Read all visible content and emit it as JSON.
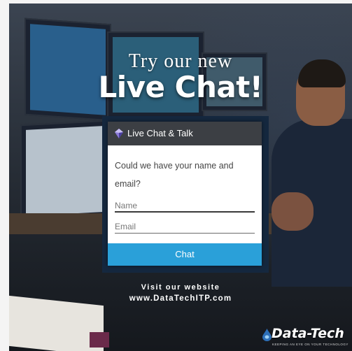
{
  "promo": {
    "headline_top": "Try our new",
    "headline_main": "Live Chat!",
    "visit_line1": "Visit our website",
    "visit_line2": "www.DataTechITP.com",
    "logo_name": "Data-Tech",
    "logo_tagline": "KEEPING AN EYE ON YOUR TECHNOLOGY"
  },
  "widget": {
    "header_icon": "gem-icon",
    "header_title": "Live Chat & Talk",
    "prompt": "Could we have your name and email?",
    "name_placeholder": "Name",
    "email_placeholder": "Email",
    "button_label": "Chat",
    "button_color": "#2aa0d9",
    "header_color": "#3c3f44"
  }
}
